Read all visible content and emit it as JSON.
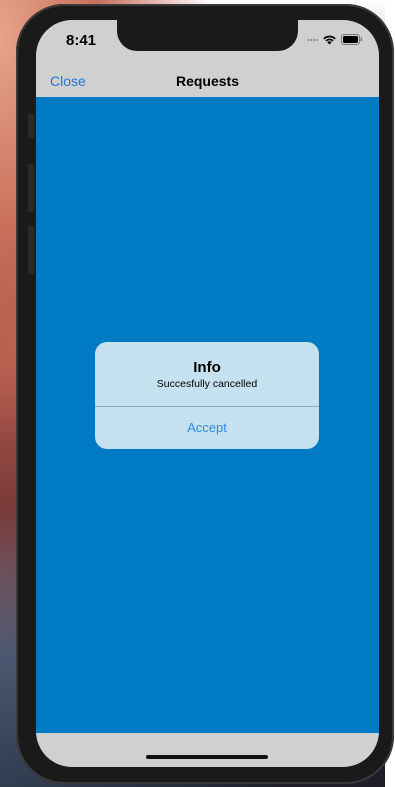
{
  "status_bar": {
    "time": "8:41",
    "icons": [
      "signal-dots-icon",
      "wifi-icon",
      "battery-icon"
    ]
  },
  "nav": {
    "close_label": "Close",
    "title": "Requests"
  },
  "alert": {
    "title": "Info",
    "message": "Succesfully cancelled",
    "button_label": "Accept"
  },
  "colors": {
    "content_background": "#007ac3",
    "bar_background": "#d0d0d0",
    "alert_background": "#c5e1ef",
    "link_blue": "#1a7bd6"
  }
}
